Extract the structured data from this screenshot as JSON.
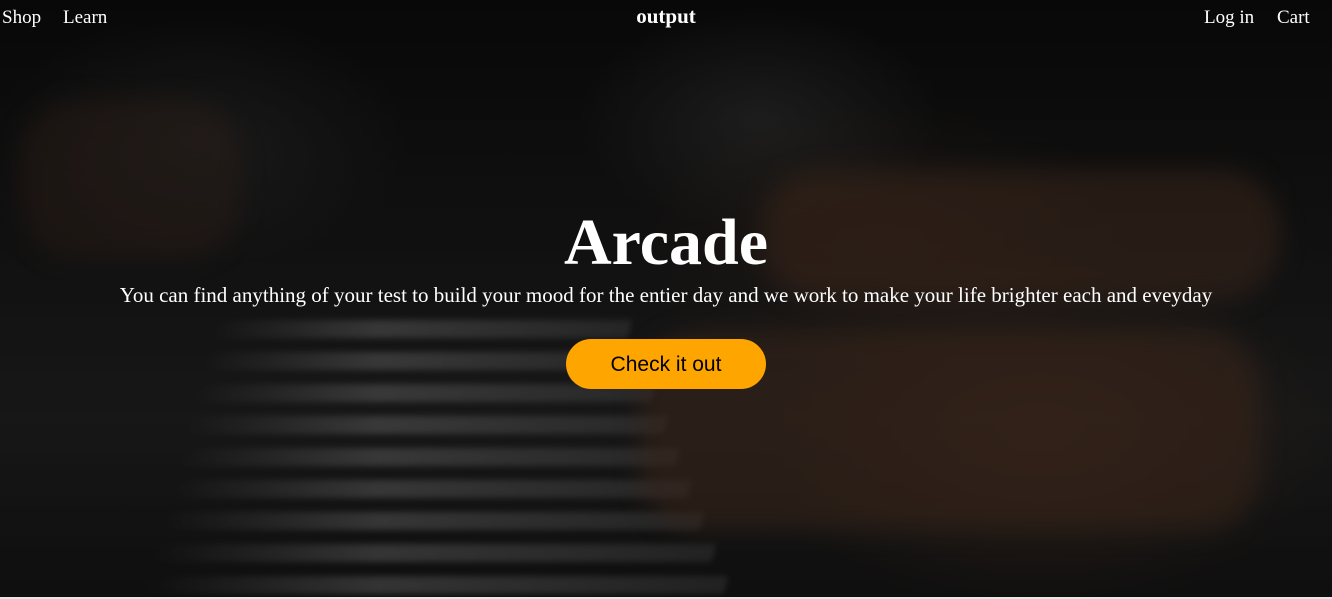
{
  "nav": {
    "left_links": [
      "Shop",
      "Learn"
    ],
    "brand": "output",
    "right_links": [
      "Log in",
      "Cart"
    ]
  },
  "hero": {
    "title": "Arcade",
    "subtitle": "You can find anything of your test to build your mood for the entier day and we work to make your life brighter each and eveyday",
    "cta_label": "Check it out",
    "background_image": "blurred-piano-hands-photo"
  },
  "colors": {
    "accent": "#ffa500",
    "text": "#ffffff"
  }
}
